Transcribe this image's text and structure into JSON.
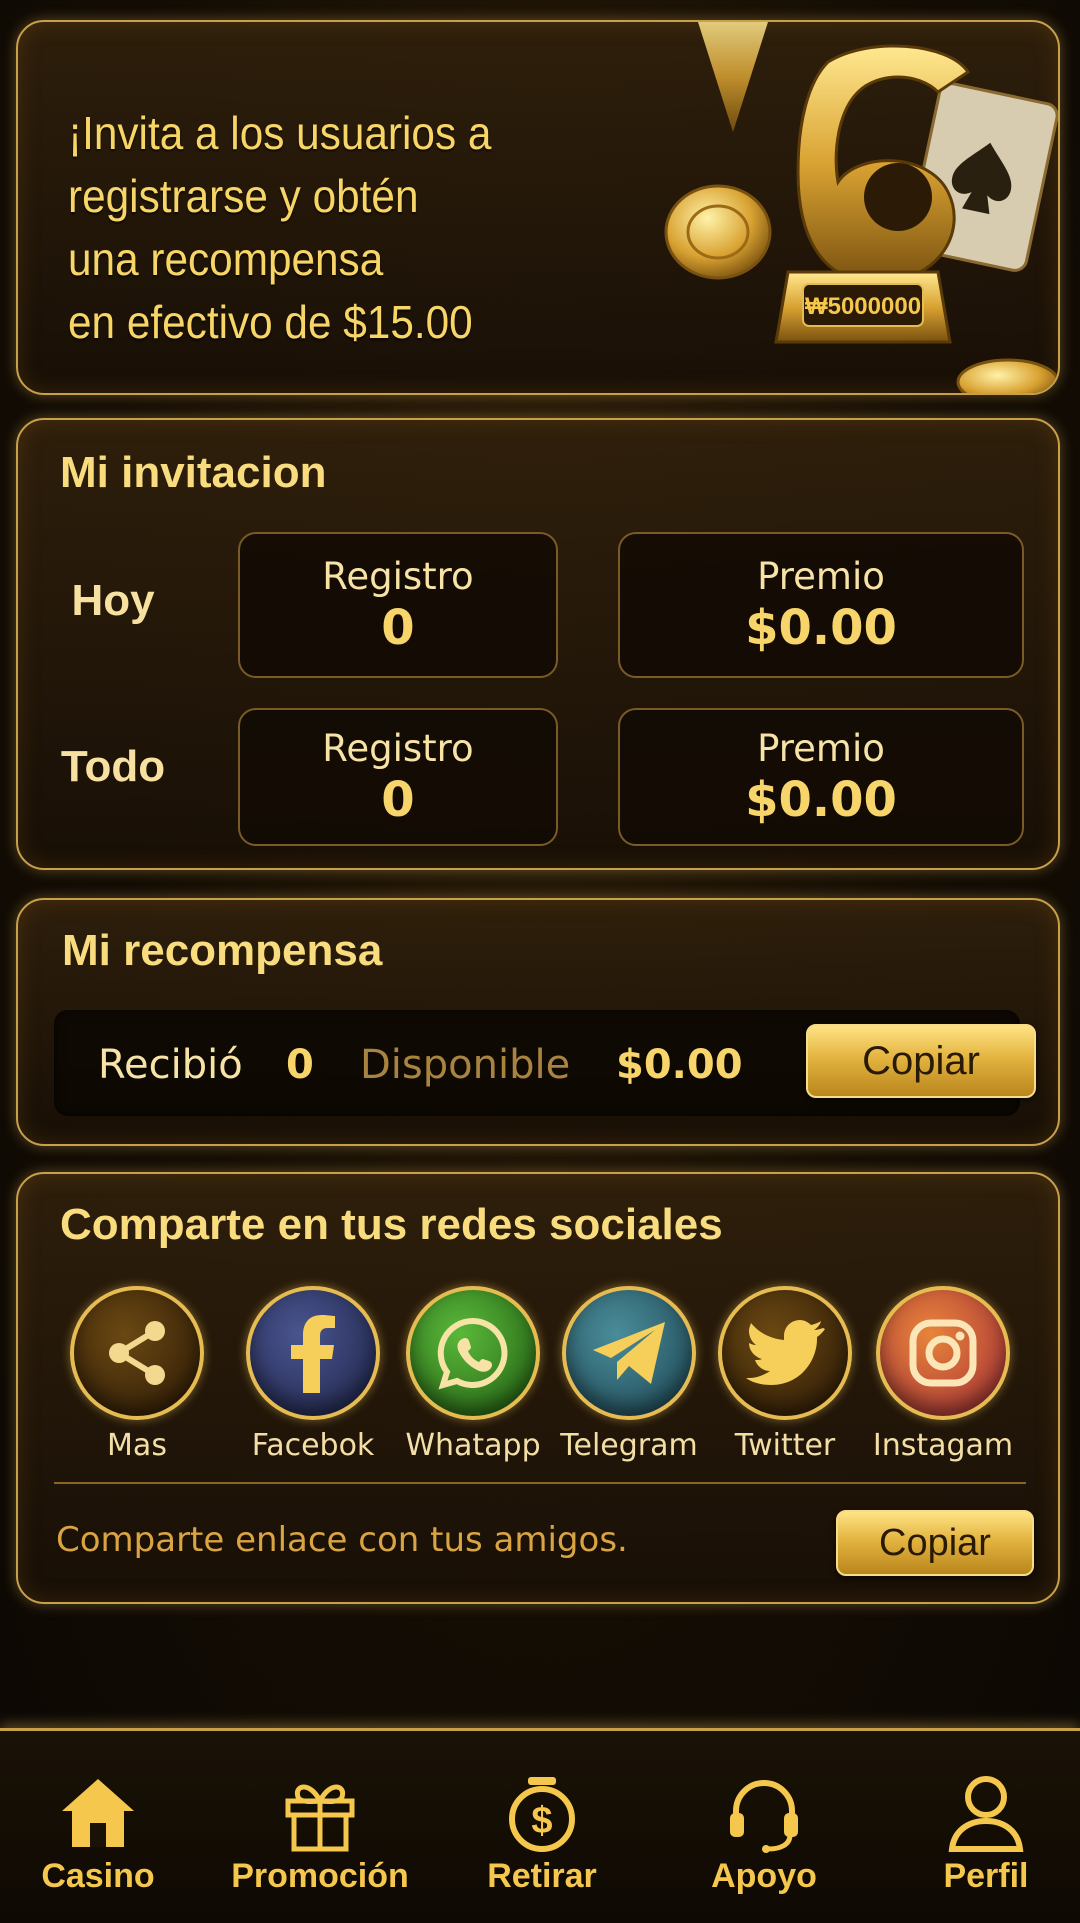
{
  "banner": {
    "lines": [
      "¡Invita a los usuarios a",
      "registrarse y obtén",
      "una recompensa",
      "en efectivo de $15.00"
    ],
    "trophy_plate": "₩5000000"
  },
  "invitation": {
    "title": "Mi invitacion",
    "rows": [
      {
        "label": "Hoy",
        "registro_label": "Registro",
        "registro_value": "0",
        "premio_label": "Premio",
        "premio_value": "$0.00"
      },
      {
        "label": "Todo",
        "registro_label": "Registro",
        "registro_value": "0",
        "premio_label": "Premio",
        "premio_value": "$0.00"
      }
    ]
  },
  "reward": {
    "title": "Mi recompensa",
    "received_label": "Recibió",
    "received_value": "0",
    "available_label": "Disponible",
    "available_value": "$0.00",
    "copy_label": "Copiar"
  },
  "social": {
    "title": "Comparte en tus redes sociales",
    "items": [
      {
        "name": "Mas",
        "icon": "share-icon",
        "color": "#3a2408"
      },
      {
        "name": "Facebok",
        "icon": "facebook-icon",
        "color": "#2c3566"
      },
      {
        "name": "Whatapp",
        "icon": "whatsapp-icon",
        "color": "#2f7a1c"
      },
      {
        "name": "Telegram",
        "icon": "telegram-icon",
        "color": "#2c6a7a"
      },
      {
        "name": "Twitter",
        "icon": "twitter-icon",
        "color": "#4a3010"
      },
      {
        "name": "Instagam",
        "icon": "instagram-icon",
        "color": "#b8452a"
      }
    ],
    "share_text": "Comparte enlace con tus amigos.",
    "copy_label": "Copiar"
  },
  "nav": {
    "items": [
      {
        "label": "Casino",
        "icon": "home-icon"
      },
      {
        "label": "Promoción",
        "icon": "gift-icon"
      },
      {
        "label": "Retirar",
        "icon": "money-bag-icon"
      },
      {
        "label": "Apoyo",
        "icon": "headset-icon"
      },
      {
        "label": "Perfil",
        "icon": "user-icon"
      }
    ]
  },
  "colors": {
    "gold": "#f5c84d",
    "border": "#c9a04a",
    "background": "#140d04"
  }
}
